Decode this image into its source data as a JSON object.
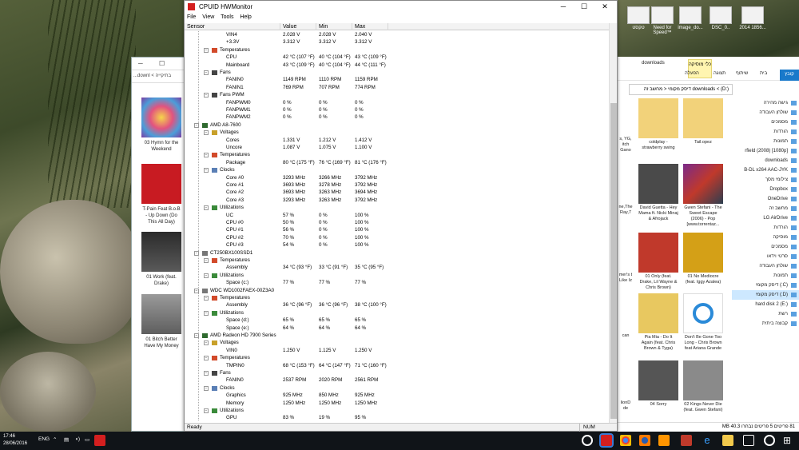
{
  "desktop": {
    "icons": [
      "טקסט",
      "Need for Speed™",
      "image_do...",
      "DSC_0..",
      "2014 1856..."
    ]
  },
  "left_window": {
    "address": "...downl < בתיקייה",
    "albums": [
      {
        "label": "03 Hymn for the Weekend",
        "color": "#c9508f"
      },
      {
        "label": "T-Pain Feat B.o.B - Up Down (Do This All Day)",
        "color": "#c81b22"
      },
      {
        "label": "01 Work (feat. Drake)",
        "color": "#3a3a3a"
      },
      {
        "label": "01 Bitch Better Have My Money",
        "color": "#7a7a7a"
      }
    ]
  },
  "hw": {
    "title": "CPUID HWMonitor",
    "menu": [
      "File",
      "View",
      "Tools",
      "Help"
    ],
    "columns": [
      "Sensor",
      "Value",
      "Min",
      "Max"
    ],
    "status": "Ready",
    "num": "NUM",
    "rows": [
      {
        "t": "s",
        "n": "VIN4",
        "v": "2.028 V",
        "mi": "2.028 V",
        "ma": "2.040 V"
      },
      {
        "t": "s",
        "n": "+3.3V",
        "v": "3.312 V",
        "mi": "3.312 V",
        "ma": "3.312 V"
      },
      {
        "t": "c",
        "n": "Temperatures",
        "g": "temp"
      },
      {
        "t": "s",
        "n": "CPU",
        "v": "42 °C  (107 °F)",
        "mi": "40 °C  (104 °F)",
        "ma": "43 °C  (109 °F)"
      },
      {
        "t": "s",
        "n": "Mainboard",
        "v": "43 °C  (109 °F)",
        "mi": "40 °C  (104 °F)",
        "ma": "44 °C  (111 °F)"
      },
      {
        "t": "c",
        "n": "Fans",
        "g": "fan"
      },
      {
        "t": "s",
        "n": "FANIN0",
        "v": "1149 RPM",
        "mi": "1110 RPM",
        "ma": "1159 RPM"
      },
      {
        "t": "s",
        "n": "FANIN1",
        "v": "769 RPM",
        "mi": "707 RPM",
        "ma": "774 RPM"
      },
      {
        "t": "c",
        "n": "Fans PWM",
        "g": "fan"
      },
      {
        "t": "s",
        "n": "FANPWM0",
        "v": "0 %",
        "mi": "0 %",
        "ma": "0 %"
      },
      {
        "t": "s",
        "n": "FANPWM1",
        "v": "0 %",
        "mi": "0 %",
        "ma": "0 %"
      },
      {
        "t": "s",
        "n": "FANPWM2",
        "v": "0 %",
        "mi": "0 %",
        "ma": "0 %"
      },
      {
        "t": "d",
        "n": "AMD A8-7600",
        "g": "cpu"
      },
      {
        "t": "c",
        "n": "Voltages",
        "g": "volt"
      },
      {
        "t": "s",
        "n": "Cores",
        "v": "1.331 V",
        "mi": "1.212 V",
        "ma": "1.412 V"
      },
      {
        "t": "s",
        "n": "Uncore",
        "v": "1.087 V",
        "mi": "1.075 V",
        "ma": "1.100 V"
      },
      {
        "t": "c",
        "n": "Temperatures",
        "g": "temp"
      },
      {
        "t": "s",
        "n": "Package",
        "v": "80 °C  (175 °F)",
        "mi": "76 °C  (169 °F)",
        "ma": "81 °C  (176 °F)"
      },
      {
        "t": "c",
        "n": "Clocks",
        "g": "clock"
      },
      {
        "t": "s",
        "n": "Core #0",
        "v": "3293 MHz",
        "mi": "3266 MHz",
        "ma": "3792 MHz"
      },
      {
        "t": "s",
        "n": "Core #1",
        "v": "3693 MHz",
        "mi": "3278 MHz",
        "ma": "3792 MHz"
      },
      {
        "t": "s",
        "n": "Core #2",
        "v": "3693 MHz",
        "mi": "3263 MHz",
        "ma": "3694 MHz"
      },
      {
        "t": "s",
        "n": "Core #3",
        "v": "3293 MHz",
        "mi": "3263 MHz",
        "ma": "3792 MHz"
      },
      {
        "t": "c",
        "n": "Utilizations",
        "g": "util"
      },
      {
        "t": "s",
        "n": "UC",
        "v": "57 %",
        "mi": "0 %",
        "ma": "100 %"
      },
      {
        "t": "s",
        "n": "CPU #0",
        "v": "50 %",
        "mi": "0 %",
        "ma": "100 %"
      },
      {
        "t": "s",
        "n": "CPU #1",
        "v": "56 %",
        "mi": "0 %",
        "ma": "100 %"
      },
      {
        "t": "s",
        "n": "CPU #2",
        "v": "70 %",
        "mi": "0 %",
        "ma": "100 %"
      },
      {
        "t": "s",
        "n": "CPU #3",
        "v": "54 %",
        "mi": "0 %",
        "ma": "100 %"
      },
      {
        "t": "d",
        "n": "CT250BX100SSD1",
        "g": "disk"
      },
      {
        "t": "c",
        "n": "Temperatures",
        "g": "temp"
      },
      {
        "t": "s",
        "n": "Assembly",
        "v": "34 °C  (93 °F)",
        "mi": "33 °C  (91 °F)",
        "ma": "35 °C  (95 °F)"
      },
      {
        "t": "c",
        "n": "Utilizations",
        "g": "util"
      },
      {
        "t": "s",
        "n": "Space (c:)",
        "v": "77 %",
        "mi": "77 %",
        "ma": "77 %"
      },
      {
        "t": "d",
        "n": "WDC WD1002FAEX-00Z3A0",
        "g": "disk"
      },
      {
        "t": "c",
        "n": "Temperatures",
        "g": "temp"
      },
      {
        "t": "s",
        "n": "Assembly",
        "v": "36 °C  (96 °F)",
        "mi": "36 °C  (96 °F)",
        "ma": "38 °C  (100 °F)"
      },
      {
        "t": "c",
        "n": "Utilizations",
        "g": "util"
      },
      {
        "t": "s",
        "n": "Space (d:)",
        "v": "65 %",
        "mi": "65 %",
        "ma": "65 %"
      },
      {
        "t": "s",
        "n": "Space (e:)",
        "v": "64 %",
        "mi": "64 %",
        "ma": "64 %"
      },
      {
        "t": "d",
        "n": "AMD Radeon HD 7900 Series",
        "g": "gpu"
      },
      {
        "t": "c",
        "n": "Voltages",
        "g": "volt"
      },
      {
        "t": "s",
        "n": "VIN0",
        "v": "1.250 V",
        "mi": "1.125 V",
        "ma": "1.250 V"
      },
      {
        "t": "c",
        "n": "Temperatures",
        "g": "temp"
      },
      {
        "t": "s",
        "n": "TMPIN0",
        "v": "68 °C  (153 °F)",
        "mi": "64 °C  (147 °F)",
        "ma": "71 °C  (160 °F)"
      },
      {
        "t": "c",
        "n": "Fans",
        "g": "fan"
      },
      {
        "t": "s",
        "n": "FANIN0",
        "v": "2537 RPM",
        "mi": "2020 RPM",
        "ma": "2561 RPM"
      },
      {
        "t": "c",
        "n": "Clocks",
        "g": "clock"
      },
      {
        "t": "s",
        "n": "Graphics",
        "v": "925 MHz",
        "mi": "850 MHz",
        "ma": "925 MHz"
      },
      {
        "t": "s",
        "n": "Memory",
        "v": "1250 MHz",
        "mi": "1250 MHz",
        "ma": "1250 MHz"
      },
      {
        "t": "c",
        "n": "Utilizations",
        "g": "util"
      },
      {
        "t": "s",
        "n": "GPU",
        "v": "83 %",
        "mi": "19 %",
        "ma": "95 %"
      }
    ]
  },
  "right_window": {
    "file_tab": "קובץ",
    "tabs": [
      "בית",
      "שיתוף",
      "תצוגה",
      "הפעלה"
    ],
    "context_tab": "כלי מוסיקה",
    "folder_title": "downloads",
    "address": "downloads < (D:) דיסק מקומי < מחשב זה",
    "nav": [
      "גישה מהירה",
      "שולחן העבודה",
      "מסמכים",
      "הורדות",
      "תמונות",
      "rfield (2008) [1080p]",
      "downloads",
      "B-DL x264 AAC-JYK",
      "צילומי מסך",
      "Dropbox",
      "OneDrive",
      "מחשב זה",
      "LG AirDrive",
      "הורדות",
      "מוסיקה",
      "מסמכים",
      "סרטי וידאו",
      "שולחן העבודה",
      "תמונות",
      "(C:) דיסק מקומי",
      "(D:) דיסק מקומי",
      "hard disk 2 (E:)",
      "רשת",
      "קבוצה ביתית"
    ],
    "nav_selected": "(D:) דיסק מקומי",
    "thumbs": [
      {
        "label": "coldplay - strawberry swing",
        "color": "#f2d27a"
      },
      {
        "label": "Tail.opez",
        "color": "#f2d27a"
      },
      {
        "label": "David Guetta - Hey Mama ft. Nicki Minaj & Afrojack",
        "color": "#4a4a4a"
      },
      {
        "label": "Gwen Stefani - The Sweet Escape (2006) - Pop [www.torrentaz...",
        "color": "#7b2a8a"
      },
      {
        "label": "01 Only (feat. Drake, Lil Wayne & Chris Brown)",
        "color": "#c0392b"
      },
      {
        "label": "01 No Mediocre (feat. Iggy Azalea)",
        "color": "#d4a017"
      },
      {
        "label": "Pia Mia - Do It Again (feat. Chris Brown & Tyga)",
        "color": "#e8c860"
      },
      {
        "label": "Don't Be Gone Too Long - Chris Brown feat Ariana Grande",
        "color": "#ffffff"
      },
      {
        "label": "04 Sorry",
        "color": "#555555"
      },
      {
        "label": "02 Kings Never Die (feat. Gwen Stefani)",
        "color": "#8a8a8a"
      }
    ],
    "partial_labels": [
      "s, YG, itch Gano",
      "ne,The Ray,7",
      "mer's t Like Iz",
      "can",
      "lionD de"
    ],
    "status": "81 פריטים   5 פריטים נבחרו 40.3 MB"
  },
  "taskbar": {
    "time": "17:46",
    "date": "28/06/2016",
    "lang": "ENG"
  }
}
